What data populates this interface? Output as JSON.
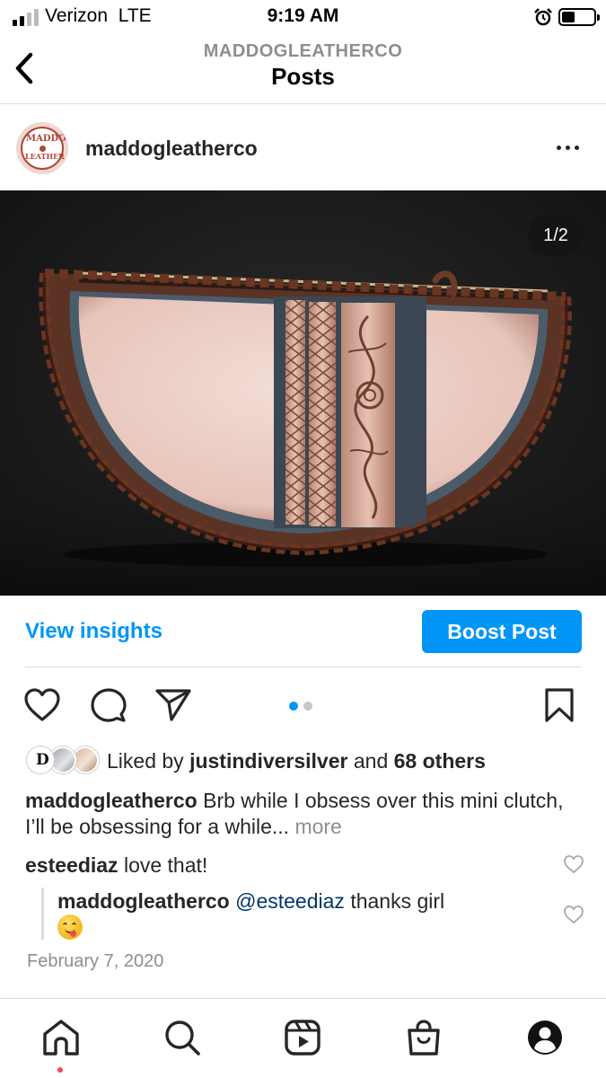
{
  "status_bar": {
    "carrier": "Verizon",
    "network": "LTE",
    "time": "9:19 AM",
    "icons": [
      "signal-icon",
      "alarm-icon",
      "battery-icon"
    ]
  },
  "header": {
    "account": "MADDOGLEATHERCO",
    "title": "Posts",
    "back_icon": "chevron-left-icon"
  },
  "post": {
    "username": "maddogleatherco",
    "avatar_text_top": "MADDOG",
    "avatar_text_bottom": "LEATHER",
    "options_icon": "more-horizontal-icon",
    "image_counter": "1/2",
    "view_insights": "View insights",
    "boost_post": "Boost Post",
    "carousel": {
      "count": 2,
      "active": 1
    },
    "action_icons": [
      "heart-icon",
      "comment-icon",
      "share-icon",
      "bookmark-icon"
    ],
    "likes": {
      "prefix": "Liked by",
      "user": "justindiversilver",
      "joiner": "and",
      "others": "68 others"
    },
    "caption": {
      "user": "maddogleatherco",
      "text": "Brb while I obsess over this mini clutch, I’ll be obsessing for a while...",
      "more": "more"
    },
    "comments": [
      {
        "user": "esteediaz",
        "text": "love that!"
      },
      {
        "user": "maddogleatherco",
        "mention": "@esteediaz",
        "text": "thanks girl",
        "emoji": "face-savoring-food"
      }
    ],
    "date": "February 7, 2020"
  },
  "bottom_nav": {
    "items": [
      "home-icon",
      "search-icon",
      "reels-icon",
      "shop-icon",
      "profile-icon"
    ],
    "active": "home-icon"
  },
  "colors": {
    "accent": "#0095f6",
    "text": "#262626",
    "muted": "#8e8e8e",
    "mention": "#00376b",
    "notification_dot": "#ed4956"
  }
}
